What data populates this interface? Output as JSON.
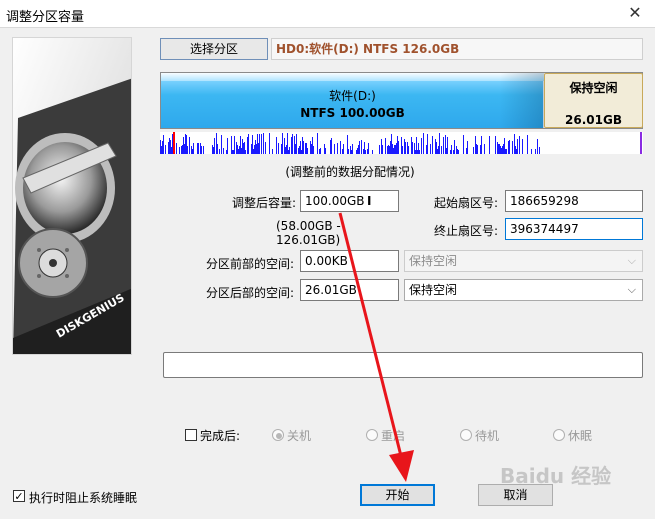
{
  "window": {
    "title": "调整分区容量",
    "close_glyph": "✕"
  },
  "toolbar": {
    "select_partition_label": "选择分区",
    "disk_info": "HD0:软件(D:) NTFS 126.0GB"
  },
  "partition_bar": {
    "main_name": "软件(D:)",
    "main_detail": "NTFS 100.00GB",
    "free_label": "保持空闲",
    "free_size": "26.01GB"
  },
  "data_map_caption": "(调整前的数据分配情况)",
  "form": {
    "new_size_label": "调整后容量:",
    "new_size_value": "100.00GB",
    "size_range": "(58.00GB - 126.01GB)",
    "start_sector_label": "起始扇区号:",
    "start_sector_value": "186659298",
    "end_sector_label": "终止扇区号:",
    "end_sector_value": "396374497",
    "space_before_label": "分区前部的空间:",
    "space_before_value": "0.00KB",
    "space_before_action": "保持空闲",
    "space_after_label": "分区后部的空间:",
    "space_after_value": "26.01GB",
    "space_after_action": "保持空闲"
  },
  "completion": {
    "label": "完成后:",
    "options": [
      "关机",
      "重启",
      "待机",
      "休眠"
    ]
  },
  "footer": {
    "prevent_sleep_label": "执行时阻止系统睡眠",
    "prevent_sleep_checked": true,
    "start_label": "开始",
    "cancel_label": "取消"
  },
  "illustration": {
    "brand": "DISKGENIUS"
  },
  "watermark": "Baidu 经验"
}
